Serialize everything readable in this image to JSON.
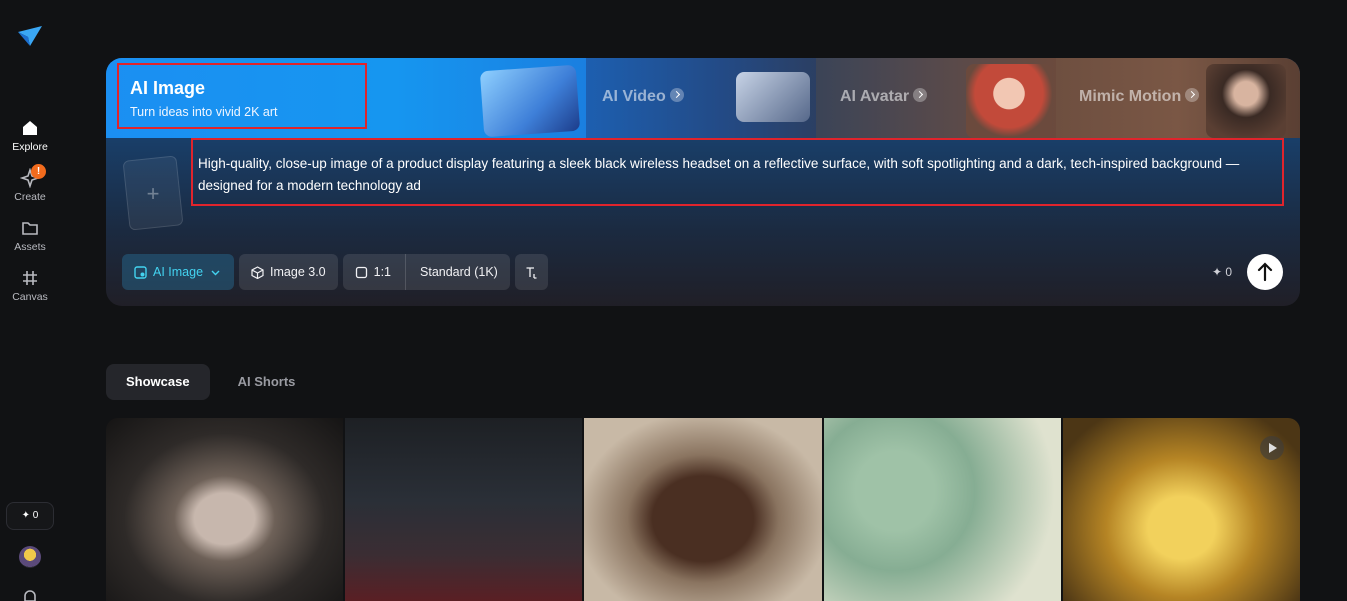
{
  "sidebar": {
    "items": [
      {
        "label": "Explore",
        "icon": "home-icon"
      },
      {
        "label": "Create",
        "icon": "sparkle-pen-icon",
        "badge": "!"
      },
      {
        "label": "Assets",
        "icon": "folder-icon"
      },
      {
        "label": "Canvas",
        "icon": "canvas-grid-icon"
      }
    ],
    "credits": "✦ 0"
  },
  "hero": {
    "tabs": [
      {
        "title": "AI Image",
        "subtitle": "Turn ideas into vivid 2K art",
        "active": true
      },
      {
        "title": "AI Video"
      },
      {
        "title": "AI Avatar"
      },
      {
        "title": "Mimic Motion"
      }
    ],
    "prompt": "High-quality, close-up image of a product display featuring a sleek black wireless headset on a reflective surface, with soft spotlighting and a dark, tech-inspired background — designed for a modern technology ad",
    "add_reference": "+",
    "toolbar": {
      "mode": "AI Image",
      "model": "Image 3.0",
      "ratio": "1:1",
      "quality": "Standard (1K)"
    },
    "credits": "✦ 0"
  },
  "feed_tabs": [
    "Showcase",
    "AI Shorts"
  ],
  "colors": {
    "accent": "#43d3f0",
    "badge": "#f26b1d",
    "highlight": "#e0242c"
  }
}
